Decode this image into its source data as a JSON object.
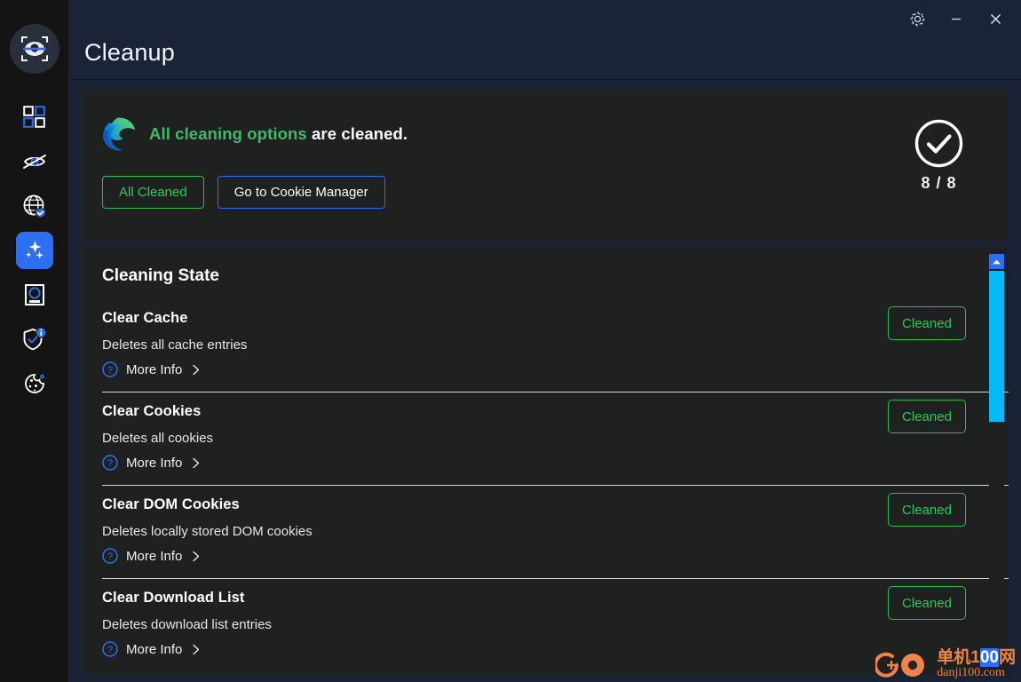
{
  "window": {
    "title": "Cleanup",
    "controls": [
      {
        "name": "settings-button",
        "icon": "gear-icon",
        "label": ""
      },
      {
        "name": "minimize-button",
        "icon": "minimize-icon",
        "label": ""
      },
      {
        "name": "close-button",
        "icon": "close-icon",
        "label": ""
      }
    ]
  },
  "sidebar": {
    "logo": {
      "icon": "eye-scan-logo",
      "label": ""
    },
    "items": [
      {
        "name": "sidebar-item-dashboard",
        "icon": "grid-squares-icon",
        "active": false
      },
      {
        "name": "sidebar-item-tracking",
        "icon": "eye-slash-icon",
        "active": false
      },
      {
        "name": "sidebar-item-network",
        "icon": "globe-shield-icon",
        "active": false
      },
      {
        "name": "sidebar-item-cleanup",
        "icon": "sparkles-icon",
        "active": true
      },
      {
        "name": "sidebar-item-storage",
        "icon": "hard-drive-icon",
        "active": false
      },
      {
        "name": "sidebar-item-security",
        "icon": "shield-info-icon",
        "active": false
      },
      {
        "name": "sidebar-item-cookies",
        "icon": "cookie-icon",
        "active": false
      }
    ]
  },
  "banner": {
    "browser_icon": "microsoft-edge-icon",
    "message_highlight": "All cleaning options",
    "message_rest": " are cleaned.",
    "buttons": [
      {
        "name": "all-cleaned-button",
        "label": "All Cleaned",
        "style": "green"
      },
      {
        "name": "go-to-cookie-manager-button",
        "label": "Go to Cookie Manager",
        "style": "blue"
      }
    ],
    "status_icon": "check-circle-icon",
    "count": "8 / 8"
  },
  "state_section": {
    "title": "Cleaning State",
    "more_info_label": "More Info",
    "items": [
      {
        "name": "Clear Cache",
        "description": "Deletes all cache entries",
        "status": "Cleaned"
      },
      {
        "name": "Clear Cookies",
        "description": "Deletes all cookies",
        "status": "Cleaned"
      },
      {
        "name": "Clear DOM Cookies",
        "description": "Deletes locally stored DOM cookies",
        "status": "Cleaned"
      },
      {
        "name": "Clear Download List",
        "description": "Deletes download list entries",
        "status": "Cleaned"
      }
    ]
  },
  "scrollbar": {
    "up_arrow": "triangle-up-icon"
  },
  "watermark": {
    "icon": "danji-logo",
    "cn_prefix": "单机1",
    "cn_highlight": "00",
    "cn_suffix": "网",
    "en": "danji100.com"
  },
  "colors": {
    "accent_blue": "#2e6ef2",
    "success_green": "#34c759",
    "scroll_cyan": "#04bbf7",
    "card_bg": "#1f2120",
    "main_bg": "#1a2235",
    "sidebar_bg": "#141414"
  }
}
